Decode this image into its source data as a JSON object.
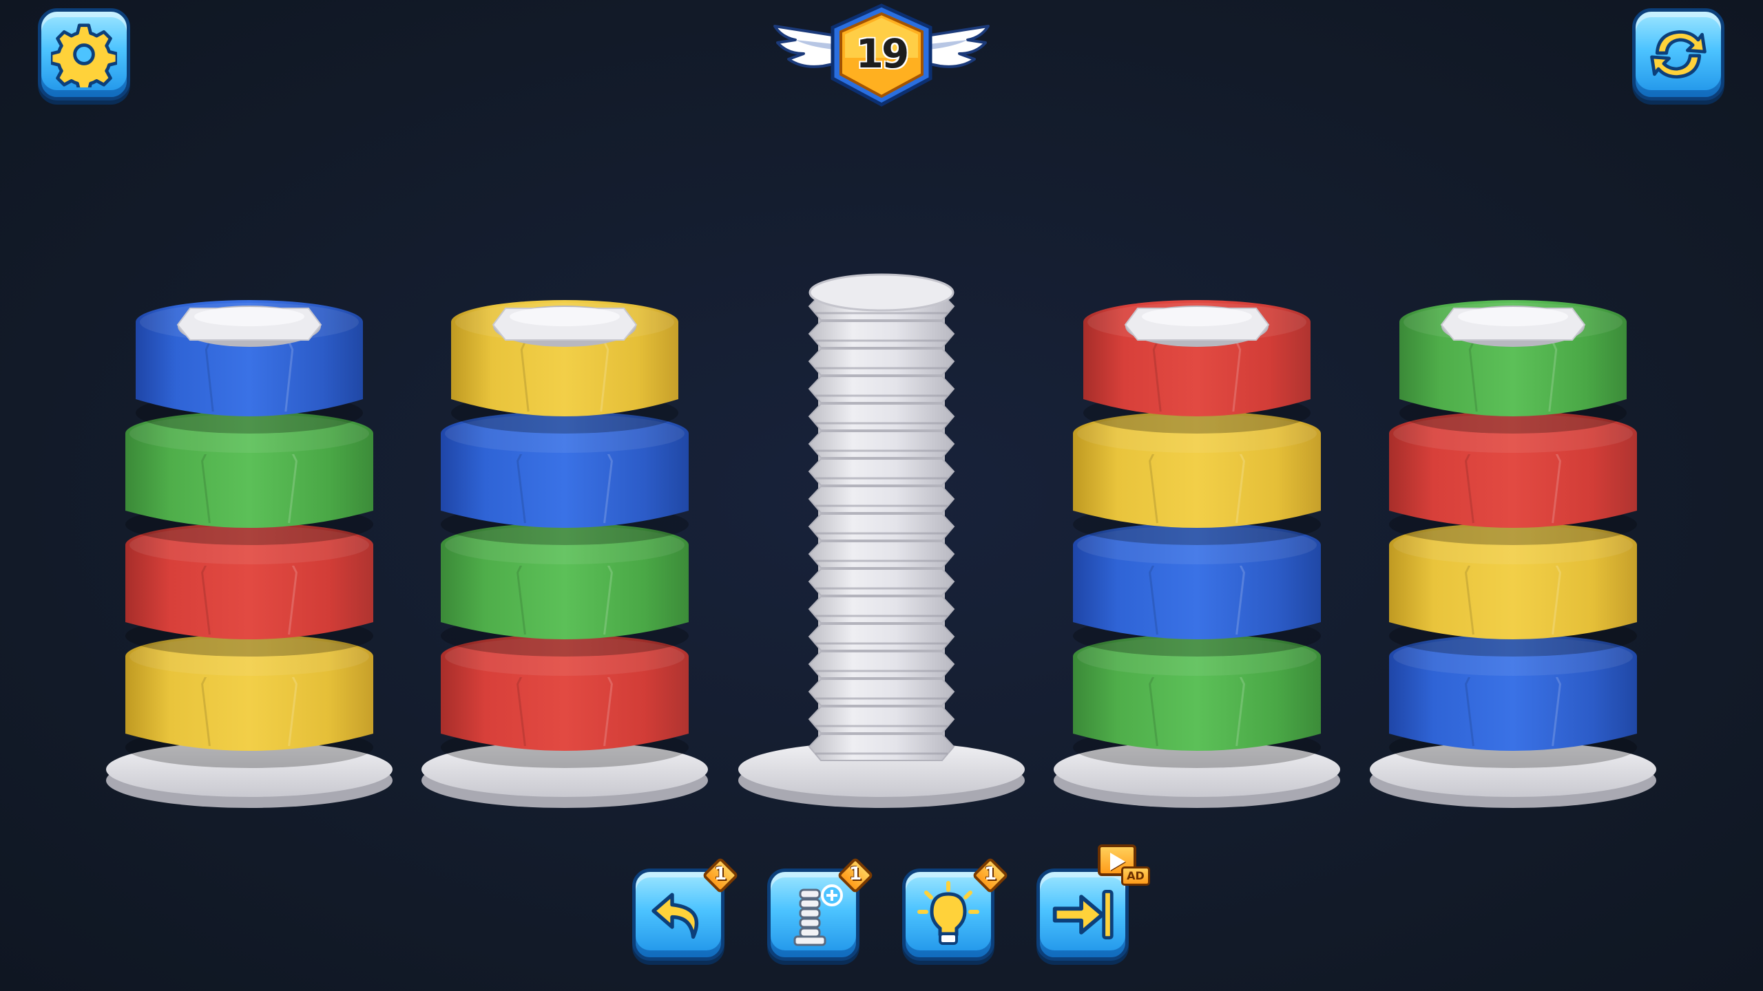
{
  "level": {
    "number": "19"
  },
  "top_bar": {
    "settings_icon": "gear-icon",
    "restart_icon": "refresh-icon"
  },
  "colors": {
    "blue": "#2f64d6",
    "green": "#4fae4a",
    "red": "#d8403a",
    "yellow": "#e9c43c",
    "bolt": "#e6e6ea"
  },
  "bolts": [
    {
      "nuts": [
        "yellow",
        "red",
        "green",
        "blue"
      ]
    },
    {
      "nuts": [
        "red",
        "green",
        "blue",
        "yellow"
      ]
    },
    {
      "nuts": []
    },
    {
      "nuts": [
        "green",
        "blue",
        "yellow",
        "red"
      ]
    },
    {
      "nuts": [
        "blue",
        "yellow",
        "red",
        "green"
      ]
    }
  ],
  "toolbar": {
    "undo": {
      "icon": "undo-arrow-icon",
      "count": "1"
    },
    "extra_bolt": {
      "icon": "add-screw-icon",
      "count": "1"
    },
    "hint": {
      "icon": "lightbulb-icon",
      "count": "1"
    },
    "skip": {
      "icon": "skip-level-icon",
      "ad_label": "AD"
    }
  }
}
